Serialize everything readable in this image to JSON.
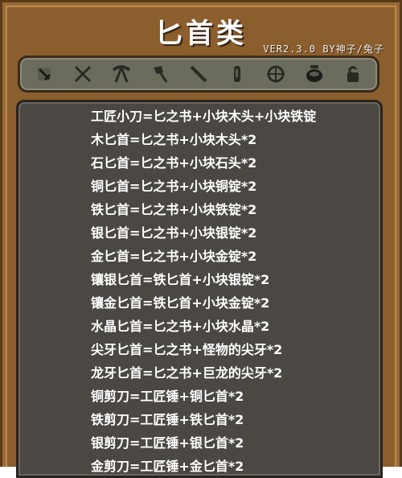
{
  "header": {
    "title": "匕首类",
    "version": "VER2.3.0 BY神子/兔子"
  },
  "toolbar": {
    "tabs": [
      {
        "icon": "sword-icon",
        "selected": true
      },
      {
        "icon": "crossed-swords-icon"
      },
      {
        "icon": "pickaxe-icon"
      },
      {
        "icon": "axe-icon"
      },
      {
        "icon": "spear-icon"
      },
      {
        "icon": "potion-icon"
      },
      {
        "icon": "bow-icon"
      },
      {
        "icon": "pot-icon"
      },
      {
        "icon": "misc-icon"
      }
    ]
  },
  "recipes": [
    "工匠小刀=匕之书+小块木头+小块铁锭",
    "木匕首=匕之书+小块木头*2",
    "石匕首=匕之书+小块石头*2",
    "铜匕首=匕之书+小块铜锭*2",
    "铁匕首=匕之书+小块铁锭*2",
    "银匕首=匕之书+小块银锭*2",
    "金匕首=匕之书+小块金锭*2",
    "镶银匕首=铁匕首+小块银锭*2",
    "镶金匕首=铁匕首+小块金锭*2",
    "水晶匕首=匕之书+小块水晶*2",
    "尖牙匕首=匕之书+怪物的尖牙*2",
    "龙牙匕首=匕之书+巨龙的尖牙*2",
    "铜剪刀=工匠锤+铜匕首*2",
    "铁剪刀=工匠锤+铁匕首*2",
    "银剪刀=工匠锤+银匕首*2",
    "金剪刀=工匠锤+金匕首*2"
  ]
}
